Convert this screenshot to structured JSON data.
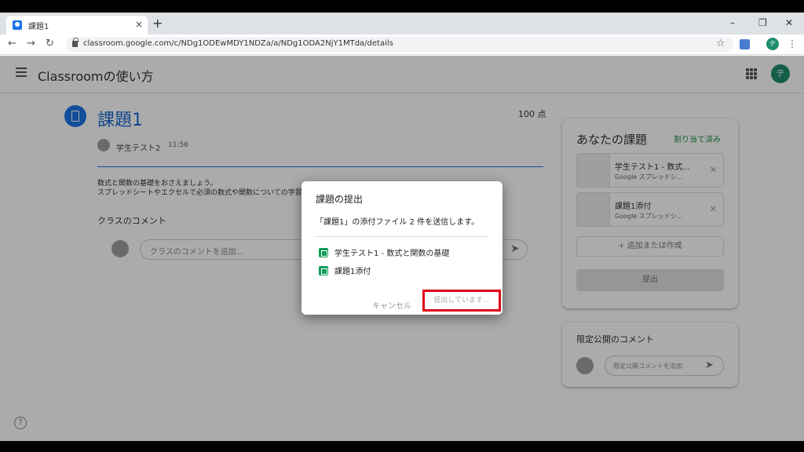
{
  "browser": {
    "tab_title": "課題1",
    "tab_close": "×",
    "new_tab": "+",
    "win_min": "–",
    "win_max": "❐",
    "win_close": "✕",
    "back": "←",
    "forward": "→",
    "reload": "↻",
    "url": "classroom.google.com/c/NDg1ODEwMDY1NDZa/a/NDg1ODA2NjY1MTda/details",
    "star": "☆",
    "profile_initial": "テ",
    "menu": "⋮"
  },
  "app": {
    "title": "Classroomの使い方",
    "avatar_initial": "テ",
    "help": "?"
  },
  "assignment": {
    "title": "課題1",
    "points": "100 点",
    "author": "学生テスト2",
    "time": "11:56",
    "description_line1": "数式と関数の基礎をおさえましょう。",
    "description_line2": "スプレッドシートやエクセルで必須の数式や関数についての学習"
  },
  "comments": {
    "heading": "クラスのコメント",
    "placeholder": "クラスのコメントを追加...",
    "send": "➤"
  },
  "your_work": {
    "title": "あなたの課題",
    "status": "割り当て済み",
    "attachments": [
      {
        "name": "学生テスト1 - 数式...",
        "type": "Google スプレッドシ...",
        "remove": "✕"
      },
      {
        "name": "課題1添付",
        "type": "Google スプレッドシ...",
        "remove": "✕"
      }
    ],
    "add_or_create": "+ 追加または作成",
    "submit": "提出"
  },
  "private_comments": {
    "title": "限定公開のコメント",
    "placeholder": "限定公開コメントを追加",
    "send": "➤"
  },
  "dialog": {
    "title": "課題の提出",
    "message": "「課題1」の添付ファイル 2 件を送信します。",
    "files": [
      "学生テスト1 - 数式と関数の基礎",
      "課題1添付"
    ],
    "cancel": "キャンセル",
    "submitting": "提出しています..."
  },
  "colors": {
    "accent_blue": "#1a73e8",
    "highlight_red": "#e0001a",
    "sheets_green": "#0f9d58",
    "avatar_green": "#1e8e6e"
  }
}
